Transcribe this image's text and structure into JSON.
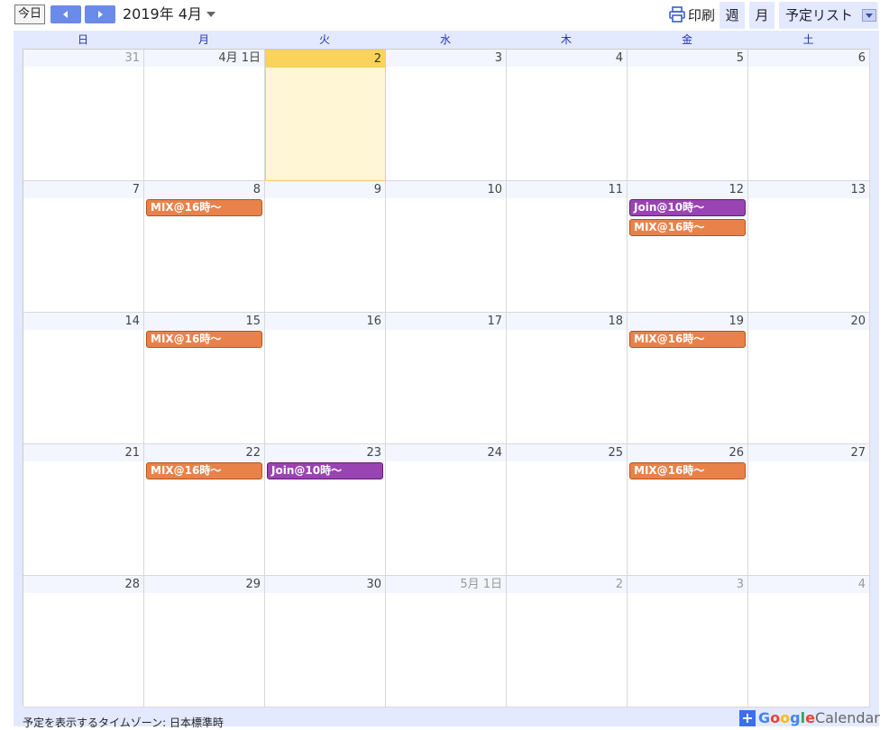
{
  "toolbar": {
    "today_label": "今日",
    "title": "2019年 4月",
    "print_label": "印刷",
    "tabs": {
      "week": "週",
      "month": "月",
      "agenda": "予定リスト"
    }
  },
  "weekdays": [
    "日",
    "月",
    "火",
    "水",
    "木",
    "金",
    "土"
  ],
  "weeks": [
    {
      "days": [
        {
          "label": "31",
          "other": true
        },
        {
          "label": "4月 1日"
        },
        {
          "label": "2",
          "today": true
        },
        {
          "label": "3"
        },
        {
          "label": "4"
        },
        {
          "label": "5"
        },
        {
          "label": "6"
        }
      ]
    },
    {
      "days": [
        {
          "label": "7"
        },
        {
          "label": "8",
          "events": [
            {
              "title": "MIX@16時～",
              "color": "mix"
            }
          ]
        },
        {
          "label": "9"
        },
        {
          "label": "10"
        },
        {
          "label": "11"
        },
        {
          "label": "12",
          "events": [
            {
              "title": "Join@10時～",
              "color": "join"
            },
            {
              "title": "MIX@16時～",
              "color": "mix"
            }
          ]
        },
        {
          "label": "13"
        }
      ]
    },
    {
      "days": [
        {
          "label": "14"
        },
        {
          "label": "15",
          "events": [
            {
              "title": "MIX@16時～",
              "color": "mix"
            }
          ]
        },
        {
          "label": "16"
        },
        {
          "label": "17"
        },
        {
          "label": "18"
        },
        {
          "label": "19",
          "events": [
            {
              "title": "MIX@16時～",
              "color": "mix"
            }
          ]
        },
        {
          "label": "20"
        }
      ]
    },
    {
      "days": [
        {
          "label": "21"
        },
        {
          "label": "22",
          "events": [
            {
              "title": "MIX@16時～",
              "color": "mix"
            }
          ]
        },
        {
          "label": "23",
          "events": [
            {
              "title": "Join@10時～",
              "color": "join"
            }
          ]
        },
        {
          "label": "24"
        },
        {
          "label": "25"
        },
        {
          "label": "26",
          "events": [
            {
              "title": "MIX@16時～",
              "color": "mix"
            }
          ]
        },
        {
          "label": "27"
        }
      ]
    },
    {
      "days": [
        {
          "label": "28"
        },
        {
          "label": "29"
        },
        {
          "label": "30"
        },
        {
          "label": "5月 1日",
          "other": true
        },
        {
          "label": "2",
          "other": true
        },
        {
          "label": "3",
          "other": true
        },
        {
          "label": "4",
          "other": true
        }
      ]
    }
  ],
  "colors": {
    "mix": "#e8824a",
    "join": "#9a43b3",
    "today": "#f9d35c",
    "accent": "#6a8ce8"
  },
  "footer": {
    "timezone_text": "予定を表示するタイムゾーン: 日本標準時",
    "badge": {
      "plus": "+",
      "google": "Google",
      "calendar": "Calendar"
    }
  }
}
